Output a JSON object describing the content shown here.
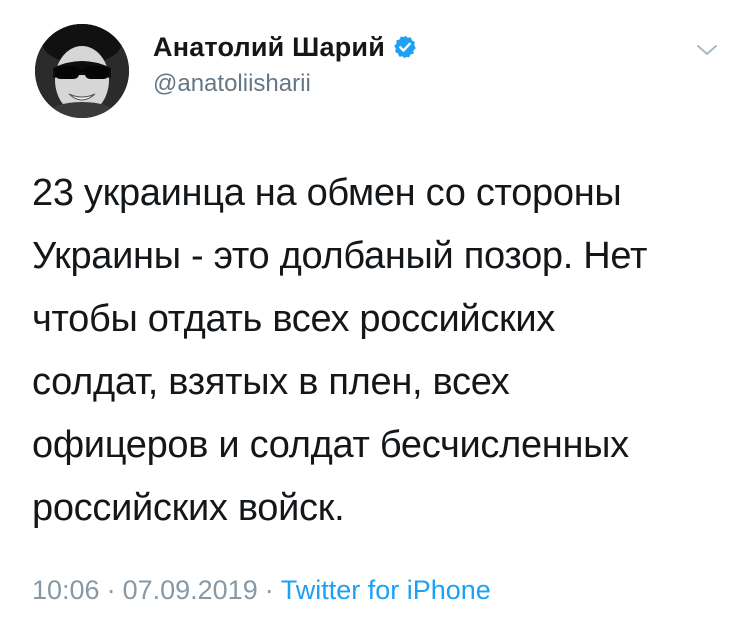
{
  "author": {
    "display_name": "Анатолий Шарий",
    "handle": "@anatoliisharii",
    "verified": true,
    "avatar": "profile-photo-sunglasses"
  },
  "tweet": {
    "text": "23 украинца на обмен со стороны\nУкраины - это долбаный позор. Нет\nчтобы отдать всех российских\nсолдат, взятых в плен, всех\nофицеров и солдат бесчисленных\nроссийских войск.",
    "time": "10:06",
    "date": "07.09.2019",
    "separator": "·",
    "source": "Twitter for iPhone"
  },
  "icons": {
    "verified": "verified-badge-icon",
    "menu": "chevron-down-icon"
  },
  "colors": {
    "name": "#14171a",
    "secondary": "#657786",
    "meta": "#8899a6",
    "link": "#1da1f2",
    "verified_badge": "#1da1f2"
  }
}
